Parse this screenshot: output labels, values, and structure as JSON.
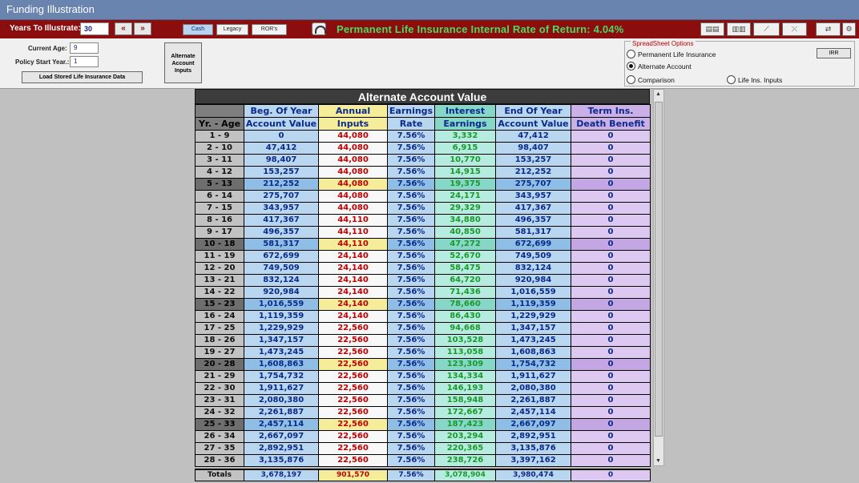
{
  "window": {
    "title": "Funding Illustration"
  },
  "toolbar": {
    "years_label": "Years To Illustrate:",
    "years_value": "30",
    "prev_label": "«",
    "next_label": "»",
    "tabs": [
      "Cash",
      "Legacy",
      "ROR's"
    ],
    "headline": "Permanent Life Insurance Internal Rate of Return: 4.04%"
  },
  "options": {
    "current_age_label": "Current Age:",
    "current_age": "9",
    "policy_start_label": "Policy Start Year.:",
    "policy_start": "1",
    "load_button": "Load Stored Life Insurance Data",
    "alt_button_lines": [
      "Alternate",
      "Account",
      "Inputs"
    ],
    "spreadsheet_legend": "SpreadSheet Options",
    "radio_permanent": "Permanent Life Insurance",
    "radio_alternate": "Alternate Account",
    "radio_comparison": "Comparison",
    "radio_lifeins": "Life Ins. Inputs",
    "irr_button": "IRR"
  },
  "grid": {
    "title": "Alternate Account Value",
    "headers": {
      "age": "Yr. - Age",
      "beg_top": "Beg. Of Year",
      "beg_bot": "Account Value",
      "inp_top": "Annual",
      "inp_bot": "Inputs",
      "rate_top": "Earnings",
      "rate_bot": "Rate",
      "int_top": "Interest",
      "int_bot": "Earnings",
      "end_top": "End Of Year",
      "end_bot": "Account Value",
      "dth_top": "Term Ins.",
      "dth_bot": "Death Benefit"
    },
    "rows": [
      [
        "1 - 9",
        "0",
        "44,080",
        "7.56%",
        "3,332",
        "47,412",
        "0"
      ],
      [
        "2 - 10",
        "47,412",
        "44,080",
        "7.56%",
        "6,915",
        "98,407",
        "0"
      ],
      [
        "3 - 11",
        "98,407",
        "44,080",
        "7.56%",
        "10,770",
        "153,257",
        "0"
      ],
      [
        "4 - 12",
        "153,257",
        "44,080",
        "7.56%",
        "14,915",
        "212,252",
        "0"
      ],
      [
        "5 - 13",
        "212,252",
        "44,080",
        "7.56%",
        "19,375",
        "275,707",
        "0"
      ],
      [
        "6 - 14",
        "275,707",
        "44,080",
        "7.56%",
        "24,171",
        "343,957",
        "0"
      ],
      [
        "7 - 15",
        "343,957",
        "44,080",
        "7.56%",
        "29,329",
        "417,367",
        "0"
      ],
      [
        "8 - 16",
        "417,367",
        "44,110",
        "7.56%",
        "34,880",
        "496,357",
        "0"
      ],
      [
        "9 - 17",
        "496,357",
        "44,110",
        "7.56%",
        "40,850",
        "581,317",
        "0"
      ],
      [
        "10 - 18",
        "581,317",
        "44,110",
        "7.56%",
        "47,272",
        "672,699",
        "0"
      ],
      [
        "11 - 19",
        "672,699",
        "24,140",
        "7.56%",
        "52,670",
        "749,509",
        "0"
      ],
      [
        "12 - 20",
        "749,509",
        "24,140",
        "7.56%",
        "58,475",
        "832,124",
        "0"
      ],
      [
        "13 - 21",
        "832,124",
        "24,140",
        "7.56%",
        "64,720",
        "920,984",
        "0"
      ],
      [
        "14 - 22",
        "920,984",
        "24,140",
        "7.56%",
        "71,436",
        "1,016,559",
        "0"
      ],
      [
        "15 - 23",
        "1,016,559",
        "24,140",
        "7.56%",
        "78,660",
        "1,119,359",
        "0"
      ],
      [
        "16 - 24",
        "1,119,359",
        "24,140",
        "7.56%",
        "86,430",
        "1,229,929",
        "0"
      ],
      [
        "17 - 25",
        "1,229,929",
        "22,560",
        "7.56%",
        "94,668",
        "1,347,157",
        "0"
      ],
      [
        "18 - 26",
        "1,347,157",
        "22,560",
        "7.56%",
        "103,528",
        "1,473,245",
        "0"
      ],
      [
        "19 - 27",
        "1,473,245",
        "22,560",
        "7.56%",
        "113,058",
        "1,608,863",
        "0"
      ],
      [
        "20 - 28",
        "1,608,863",
        "22,560",
        "7.56%",
        "123,309",
        "1,754,732",
        "0"
      ],
      [
        "21 - 29",
        "1,754,732",
        "22,560",
        "7.56%",
        "134,334",
        "1,911,627",
        "0"
      ],
      [
        "22 - 30",
        "1,911,627",
        "22,560",
        "7.56%",
        "146,193",
        "2,080,380",
        "0"
      ],
      [
        "23 - 31",
        "2,080,380",
        "22,560",
        "7.56%",
        "158,948",
        "2,261,887",
        "0"
      ],
      [
        "24 - 32",
        "2,261,887",
        "22,560",
        "7.56%",
        "172,667",
        "2,457,114",
        "0"
      ],
      [
        "25 - 33",
        "2,457,114",
        "22,560",
        "7.56%",
        "187,423",
        "2,667,097",
        "0"
      ],
      [
        "26 - 34",
        "2,667,097",
        "22,560",
        "7.56%",
        "203,294",
        "2,892,951",
        "0"
      ],
      [
        "27 - 35",
        "2,892,951",
        "22,560",
        "7.56%",
        "220,365",
        "3,135,876",
        "0"
      ],
      [
        "28 - 36",
        "3,135,876",
        "22,560",
        "7.56%",
        "238,726",
        "3,397,162",
        "0"
      ]
    ],
    "highlight_every": 5,
    "totals": [
      "Totals",
      "3,678,197",
      "901,570",
      "7.56%",
      "3,078,904",
      "3,980,474",
      "0"
    ]
  }
}
